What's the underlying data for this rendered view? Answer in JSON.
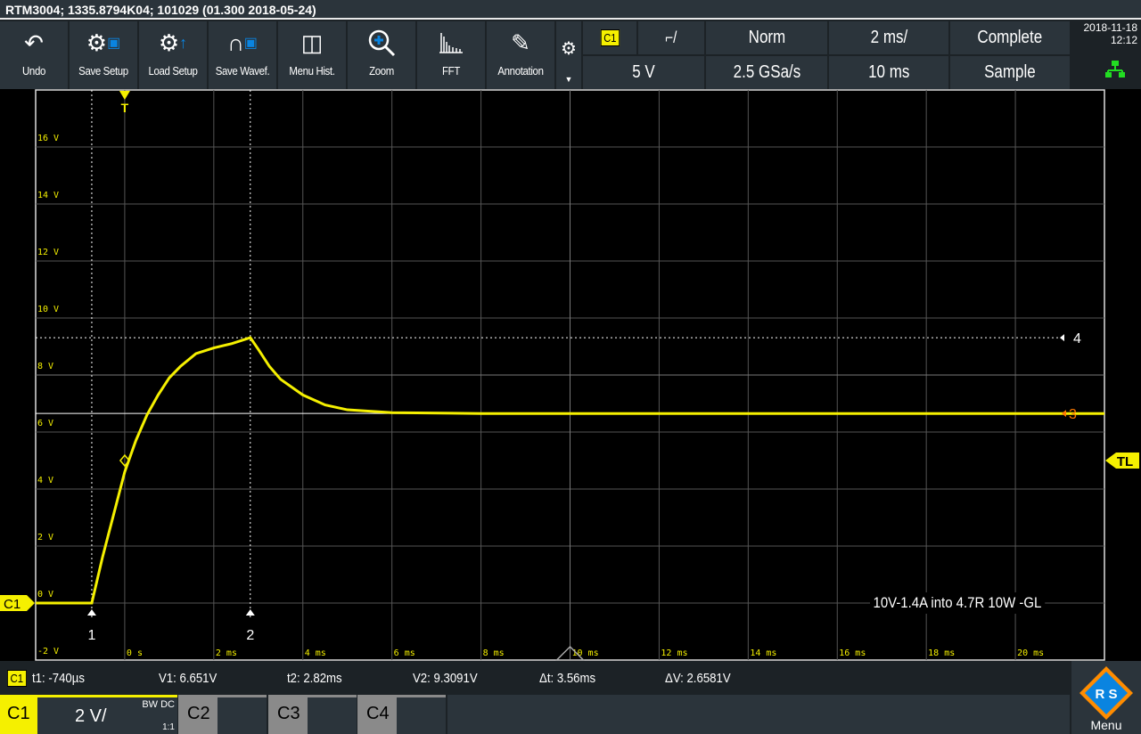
{
  "title": "RTM3004; 1335.8794K04; 101029 (01.300 2018-05-24)",
  "toolbar": [
    {
      "label": "Undo",
      "icon": "undo-arrow-icon"
    },
    {
      "label": "Save Setup",
      "icon": "gear-save-icon"
    },
    {
      "label": "Load Setup",
      "icon": "gear-upload-icon"
    },
    {
      "label": "Save Wavef.",
      "icon": "waveform-save-icon"
    },
    {
      "label": "Menu Hist.",
      "icon": "book-icon"
    },
    {
      "label": "Zoom",
      "icon": "zoom-in-icon"
    },
    {
      "label": "FFT",
      "icon": "fft-spectrum-icon"
    },
    {
      "label": "Annotation",
      "icon": "pencil-icon"
    }
  ],
  "trigger": {
    "source": "C1",
    "slope": "⎍",
    "mode": "Norm",
    "level": "5 V",
    "timebase": "2 ms/",
    "sample_rate": "2.5 GSa/s",
    "record": "10 ms",
    "acq_state": "Complete",
    "acq_mode": "Sample"
  },
  "datetime": {
    "date": "2018-11-18",
    "time": "12:12"
  },
  "colors": {
    "trace": "#f5f000",
    "accent": "#0a84e0",
    "cursor3": "#ff7a00",
    "network": "#22dd22"
  },
  "markers": {
    "trigger": "T",
    "trigger_level": "TL",
    "channel": "C1",
    "cursor1": "1",
    "cursor2": "2",
    "hcursor1": "3",
    "hcursor2": "4"
  },
  "annotation": "10V-1.4A into 4.7R 10W -GL",
  "measurements": {
    "channel": "C1",
    "t1": "t1: -740µs",
    "v1": "V1: 6.651V",
    "t2": "t2: 2.82ms",
    "v2": "V2: 9.3091V",
    "dt": "Δt: 3.56ms",
    "dv": "ΔV: 2.6581V"
  },
  "channels": {
    "c1": "C1",
    "c1_scale": "2 V/",
    "c1_bw": "BW DC",
    "c1_ratio": "1:1",
    "c2": "C2",
    "c3": "C3",
    "c4": "C4"
  },
  "menu_label": "Menu",
  "chart_data": {
    "type": "line",
    "ylabels": [
      "16 V",
      "14 V",
      "12 V",
      "10 V",
      "8 V",
      "6 V",
      "4 V",
      "2 V",
      "0 V",
      "-2 V"
    ],
    "xlabels": [
      "0 s",
      "2 ms",
      "4 ms",
      "6 ms",
      "8 ms",
      "10 ms",
      "12 ms",
      "14 ms",
      "16 ms",
      "18 ms",
      "20 ms"
    ],
    "xlim_ms": [
      -2,
      22
    ],
    "ylim_V": [
      -2,
      18
    ],
    "cursors": {
      "t1_ms": -0.74,
      "t2_ms": 2.82,
      "v1_V": 6.651,
      "v2_V": 9.3091
    },
    "trigger_level_V": 5,
    "series": [
      {
        "name": "C1",
        "points": [
          [
            -2,
            0
          ],
          [
            -0.74,
            0
          ],
          [
            -0.5,
            1.6
          ],
          [
            -0.25,
            3.1
          ],
          [
            0,
            4.6
          ],
          [
            0.25,
            5.7
          ],
          [
            0.5,
            6.6
          ],
          [
            0.75,
            7.3
          ],
          [
            1,
            7.9
          ],
          [
            1.25,
            8.3
          ],
          [
            1.6,
            8.75
          ],
          [
            2,
            8.95
          ],
          [
            2.4,
            9.1
          ],
          [
            2.82,
            9.31
          ],
          [
            3,
            8.9
          ],
          [
            3.25,
            8.3
          ],
          [
            3.5,
            7.85
          ],
          [
            4,
            7.3
          ],
          [
            4.5,
            6.95
          ],
          [
            5,
            6.78
          ],
          [
            6,
            6.68
          ],
          [
            8,
            6.65
          ],
          [
            22,
            6.65
          ]
        ]
      }
    ]
  }
}
